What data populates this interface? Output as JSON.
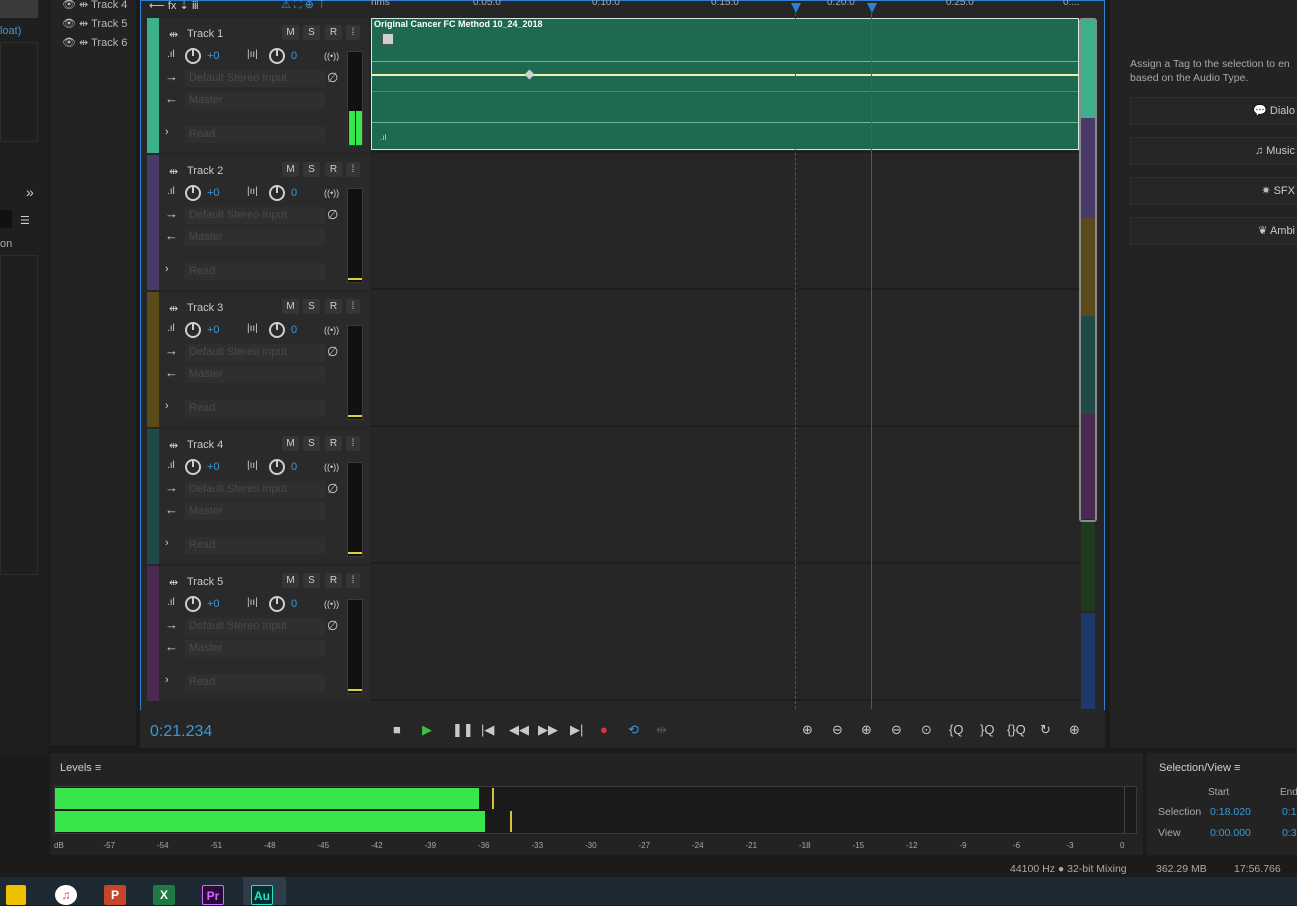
{
  "track_list": {
    "items": [
      {
        "label": "Track 4"
      },
      {
        "label": "Track 5"
      },
      {
        "label": "Track 6"
      }
    ]
  },
  "left_stub": {
    "float_text": "loat)",
    "on_text": "on"
  },
  "tracks": [
    {
      "name": "Track 1",
      "color": "#3cb08a",
      "vol": "+0",
      "pan": "0",
      "input": "Default Stereo Input",
      "output": "Master",
      "mode": "Read"
    },
    {
      "name": "Track 2",
      "color": "#4a3a6a",
      "vol": "+0",
      "pan": "0",
      "input": "Default Stereo Input",
      "output": "Master",
      "mode": "Read"
    },
    {
      "name": "Track 3",
      "color": "#5a4a1a",
      "vol": "+0",
      "pan": "0",
      "input": "Default Stereo Input",
      "output": "Master",
      "mode": "Read"
    },
    {
      "name": "Track 4",
      "color": "#1f4a48",
      "vol": "+0",
      "pan": "0",
      "input": "Default Stereo Input",
      "output": "Master",
      "mode": "Read"
    },
    {
      "name": "Track 5",
      "color": "#4a2a50",
      "vol": "+0",
      "pan": "0",
      "input": "Default Stereo Input",
      "output": "Master",
      "mode": "Read"
    }
  ],
  "buttons": {
    "mute": "M",
    "solo": "S",
    "record": "R"
  },
  "clip": {
    "title": "Original Cancer FC Method 10_24_2018",
    "color": "#1e6a50"
  },
  "ruler": {
    "unit": "hms",
    "ticks": [
      "0:05.0",
      "0:10.0",
      "0:15.0",
      "0:20.0",
      "0:25.0",
      "0:..."
    ]
  },
  "transport": {
    "time": "0:21.234"
  },
  "right_panel": {
    "hint": "Assign a Tag to the selection to en based on the Audio Type.",
    "hint_line1": "Assign a Tag to the selection to en",
    "hint_line2": "based on the Audio Type.",
    "buttons": [
      "Dialo",
      "Music",
      "SFX",
      "Ambi"
    ]
  },
  "levels": {
    "title": "Levels",
    "scale": [
      "dB",
      "-57",
      "-54",
      "-51",
      "-48",
      "-45",
      "-42",
      "-39",
      "-36",
      "-33",
      "-30",
      "-27",
      "-24",
      "-21",
      "-18",
      "-15",
      "-12",
      "-9",
      "-6",
      "-3",
      "0"
    ],
    "left_level_db": -36.2,
    "right_level_db": -35.9,
    "left_peak_db": -35.5,
    "right_peak_db": -34.5
  },
  "selection_view": {
    "title": "Selection/View",
    "col_start": "Start",
    "col_end": "End",
    "rows": [
      {
        "label": "Selection",
        "start": "0:18.020",
        "end": "0:1"
      },
      {
        "label": "View",
        "start": "0:00.000",
        "end": "0:3"
      }
    ]
  },
  "status": {
    "rate": "44100 Hz ● 32-bit Mixing",
    "mem": "362.29 MB",
    "time": "17:56.766"
  },
  "taskbar": {
    "apps": [
      "P",
      "X",
      "Pr",
      "Au"
    ]
  },
  "colors": {
    "accent": "#2f7fd6",
    "clip": "#1e6a50",
    "meter": "#37e64a"
  }
}
